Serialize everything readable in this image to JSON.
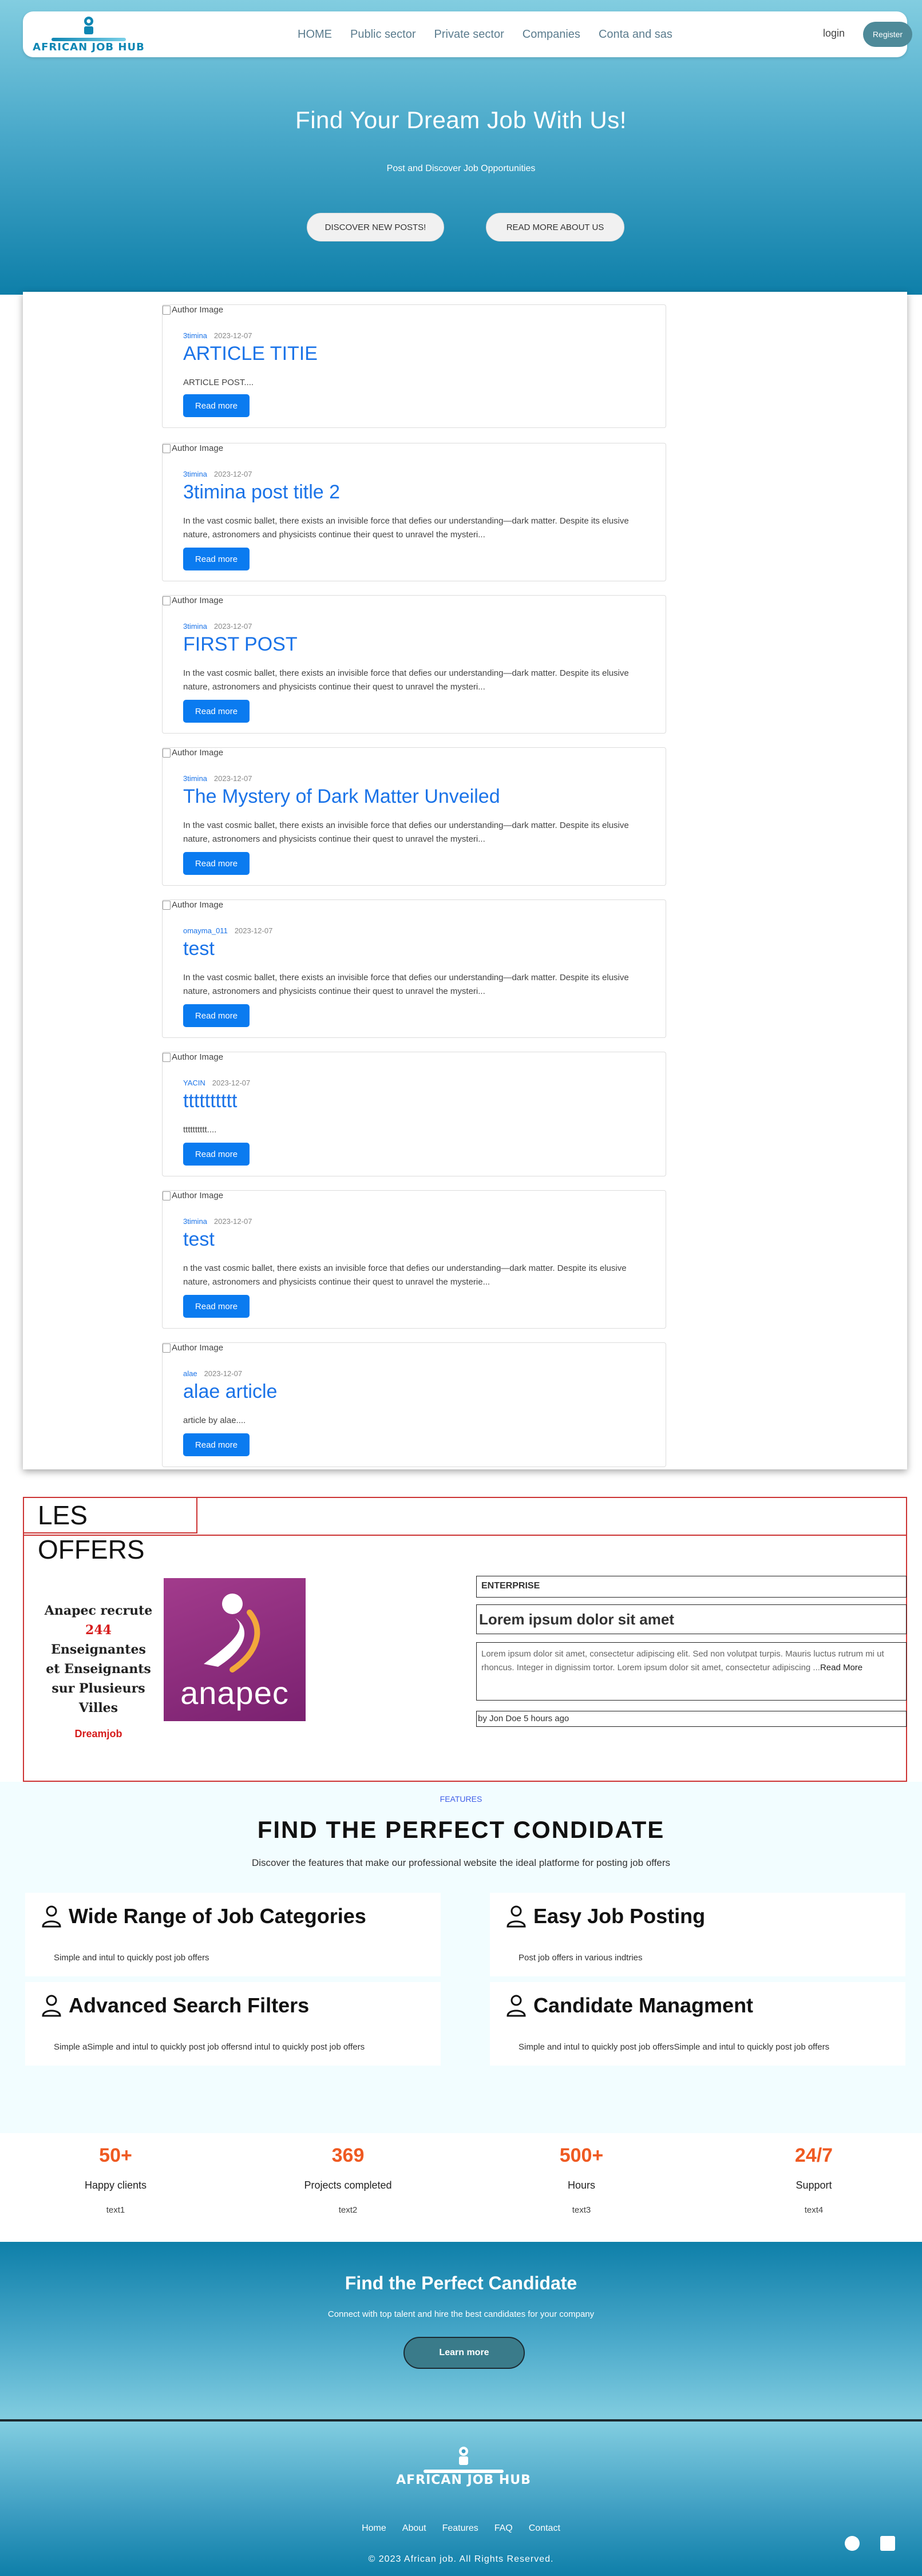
{
  "nav": {
    "logo_text": "AFRICAN JOB HUB",
    "links": [
      "HOME",
      "Public sector",
      "Private sector",
      "Companies",
      "Conta and sas"
    ],
    "login": "login",
    "register": "Register"
  },
  "hero": {
    "title": "Find Your Dream Job With Us!",
    "subtitle": "Post and Discover Job Opportunities",
    "btn_discover": "DISCOVER NEW POSTS!",
    "btn_about": "READ MORE ABOUT US"
  },
  "posts": [
    {
      "img_alt": "Author Image",
      "author": "3timina",
      "date": "2023-12-07",
      "title": "ARTICLE TITIE",
      "excerpt": "ARTICLE POST....",
      "read_more": "Read more"
    },
    {
      "img_alt": "Author Image",
      "author": "3timina",
      "date": "2023-12-07",
      "title": "3timina post title 2",
      "excerpt": "In the vast cosmic ballet, there exists an invisible force that defies our understanding—dark matter. Despite its elusive nature, astronomers and physicists continue their quest to unravel the mysteri...",
      "read_more": "Read more"
    },
    {
      "img_alt": "Author Image",
      "author": "3timina",
      "date": "2023-12-07",
      "title": "FIRST POST",
      "excerpt": "In the vast cosmic ballet, there exists an invisible force that defies our understanding—dark matter. Despite its elusive nature, astronomers and physicists continue their quest to unravel the mysteri...",
      "read_more": "Read more"
    },
    {
      "img_alt": "Author Image",
      "author": "3timina",
      "date": "2023-12-07",
      "title": "The Mystery of Dark Matter Unveiled",
      "excerpt": "In the vast cosmic ballet, there exists an invisible force that defies our understanding—dark matter. Despite its elusive nature, astronomers and physicists continue their quest to unravel the mysteri...",
      "read_more": "Read more"
    },
    {
      "img_alt": "Author Image",
      "author": "omayma_011",
      "date": "2023-12-07",
      "title": "test",
      "excerpt": "In the vast cosmic ballet, there exists an invisible force that defies our understanding—dark matter. Despite its elusive nature, astronomers and physicists continue their quest to unravel the mysteri...",
      "read_more": "Read more"
    },
    {
      "img_alt": "Author Image",
      "author": "YACIN",
      "date": "2023-12-07",
      "title": "tttttttttt",
      "excerpt": "tttttttttt....",
      "read_more": "Read more"
    },
    {
      "img_alt": "Author Image",
      "author": "3timina",
      "date": "2023-12-07",
      "title": "test",
      "excerpt": "n the vast cosmic ballet, there exists an invisible force that defies our understanding—dark matter. Despite its elusive nature, astronomers and physicists continue their quest to unravel the mysterie...",
      "read_more": "Read more"
    },
    {
      "img_alt": "Author Image",
      "author": "alae",
      "date": "2023-12-07",
      "title": "alae article",
      "excerpt": "article by alae....",
      "read_more": "Read more"
    }
  ],
  "offers": {
    "tab": "LES OFFERS",
    "card_line1": "Anapec recrute",
    "card_number": "244",
    "card_line2": "Enseignantes",
    "card_line3": "et Enseignants",
    "card_line4": "sur Plusieurs",
    "card_line5": "Villes",
    "card_brand": "Dreamjob",
    "anapec_name": "anapec",
    "enterprise_label": "ENTERPRISE",
    "enterprise_title": "Lorem ipsum dolor sit amet",
    "enterprise_text": "Lorem ipsum dolor sit amet, consectetur adipiscing elit. Sed non volutpat turpis. Mauris luctus rutrum mi ut rhoncus. Integer in dignissim tortor. Lorem ipsum dolor sit amet, consectetur adipiscing ...",
    "enterprise_read_more": "Read More",
    "enterprise_by": "by Jon Doe 5 hours ago"
  },
  "features": {
    "kicker": "FEATURES",
    "title": "FIND THE PERFECT CONDIDATE",
    "subtitle": "Discover the features that make our professional website the ideal platforme for posting job offers",
    "cards": [
      {
        "title": "Wide Range of Job Categories",
        "desc": "Simple and intul to quickly post job offers"
      },
      {
        "title": "Easy Job Posting",
        "desc": "Post job offers in various indtries"
      },
      {
        "title": "Advanced Search Filters",
        "desc": "Simple aSimple and intul to quickly post job offersnd intul to quickly post job offers"
      },
      {
        "title": "Candidate Managment",
        "desc": "Simple and intul to quickly post job offersSimple and intul to quickly post job offers"
      }
    ]
  },
  "stats": [
    {
      "num": "50+",
      "label": "Happy clients",
      "sub": "text1"
    },
    {
      "num": "369",
      "label": "Projects completed",
      "sub": "text2"
    },
    {
      "num": "500+",
      "label": "Hours",
      "sub": "text3"
    },
    {
      "num": "24/7",
      "label": "Support",
      "sub": "text4"
    }
  ],
  "cta": {
    "title": "Find the Perfect Candidate",
    "subtitle": "Connect with top talent and hire the best candidates for your company",
    "button": "Learn more"
  },
  "footer": {
    "logo_text": "AFRICAN JOB HUB",
    "links": [
      "Home",
      "About",
      "Features",
      "FAQ",
      "Contact"
    ],
    "copyright": "© 2023 African job. All Rights Reserved."
  },
  "colors": {
    "accent": "#0e7fa9",
    "link_blue": "#1a73e8",
    "stat_orange": "#ef5a22",
    "offers_border": "#cc3333"
  }
}
